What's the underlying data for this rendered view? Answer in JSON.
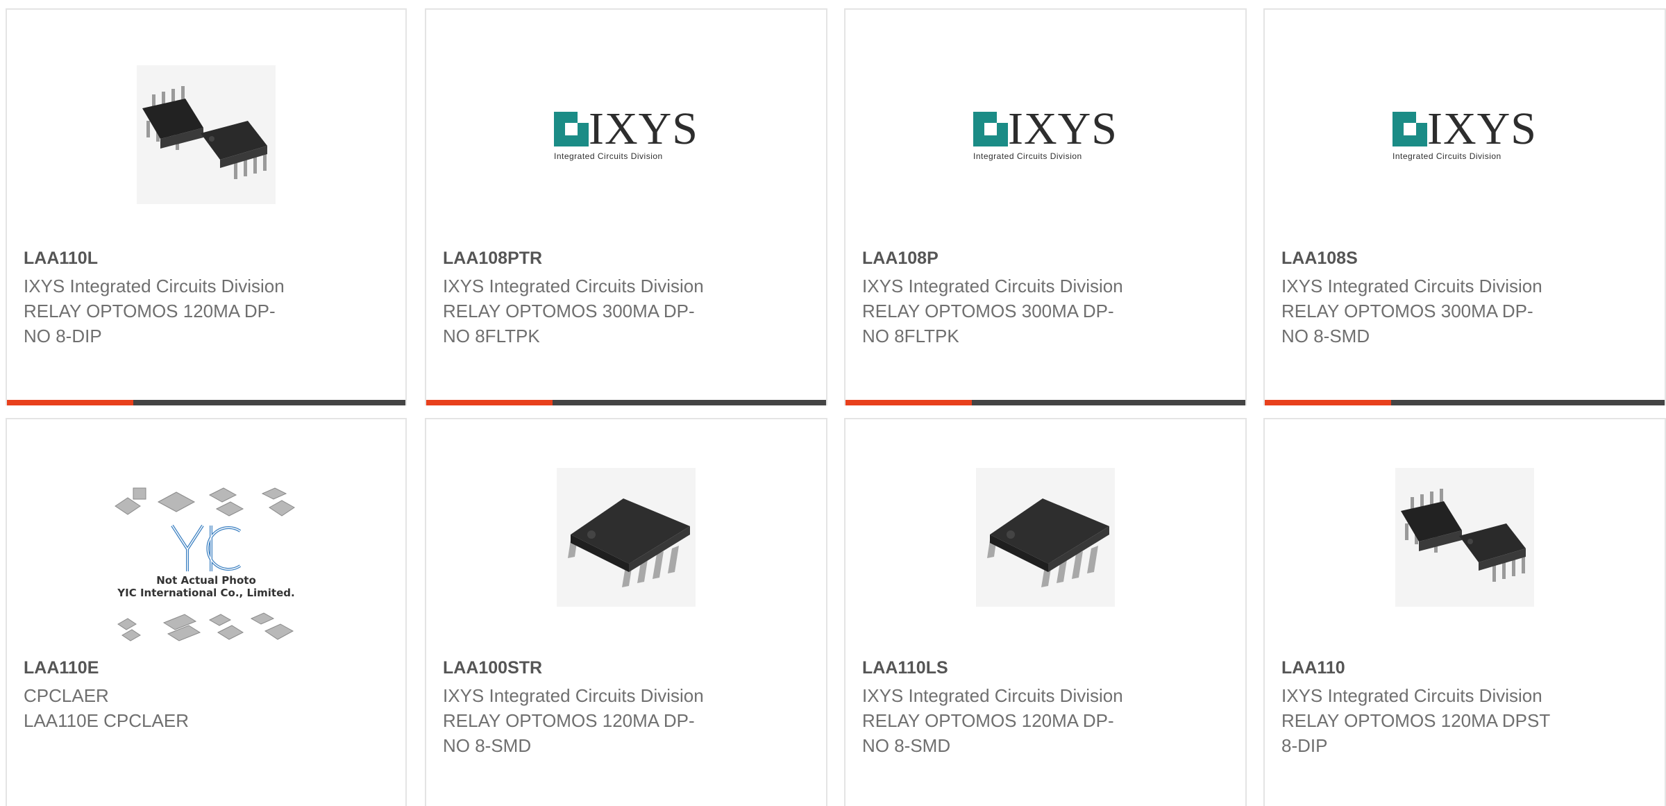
{
  "colors": {
    "accent": "#e8401c",
    "bar": "#444444",
    "ixys_teal": "#1b8c86"
  },
  "products": [
    {
      "part": "LAA110L",
      "manufacturer": "IXYS Integrated Circuits Division",
      "desc1": "RELAY OPTOMOS 120MA DP-",
      "desc2": "NO 8-DIP",
      "image": "dip-chip-photo"
    },
    {
      "part": "LAA108PTR",
      "manufacturer": "IXYS Integrated Circuits Division",
      "desc1": "RELAY OPTOMOS 300MA DP-",
      "desc2": "NO 8FLTPK",
      "image": "ixys-logo"
    },
    {
      "part": "LAA108P",
      "manufacturer": "IXYS Integrated Circuits Division",
      "desc1": "RELAY OPTOMOS 300MA DP-",
      "desc2": "NO 8FLTPK",
      "image": "ixys-logo"
    },
    {
      "part": "LAA108S",
      "manufacturer": "IXYS Integrated Circuits Division",
      "desc1": "RELAY OPTOMOS 300MA DP-",
      "desc2": "NO 8-SMD",
      "image": "ixys-logo"
    },
    {
      "part": "LAA110E",
      "manufacturer": "CPCLAER",
      "desc1": "LAA110E CPCLAER",
      "desc2": "",
      "image": "yic-placeholder"
    },
    {
      "part": "LAA100STR",
      "manufacturer": "IXYS Integrated Circuits Division",
      "desc1": "RELAY OPTOMOS 120MA DP-",
      "desc2": "NO 8-SMD",
      "image": "smd-chip-photo"
    },
    {
      "part": "LAA110LS",
      "manufacturer": "IXYS Integrated Circuits Division",
      "desc1": "RELAY OPTOMOS 120MA DP-",
      "desc2": "NO 8-SMD",
      "image": "smd-chip-photo"
    },
    {
      "part": "LAA110",
      "manufacturer": "IXYS Integrated Circuits Division",
      "desc1": "RELAY OPTOMOS 120MA DPST",
      "desc2": "8-DIP",
      "image": "dip-chip-photo"
    }
  ],
  "logo": {
    "ixys_text": "IXYS",
    "ixys_sub": "Integrated Circuits Division"
  },
  "yic": {
    "monogram": "YIC",
    "line1": "Not Actual Photo",
    "line2": "YIC International Co., Limited."
  }
}
